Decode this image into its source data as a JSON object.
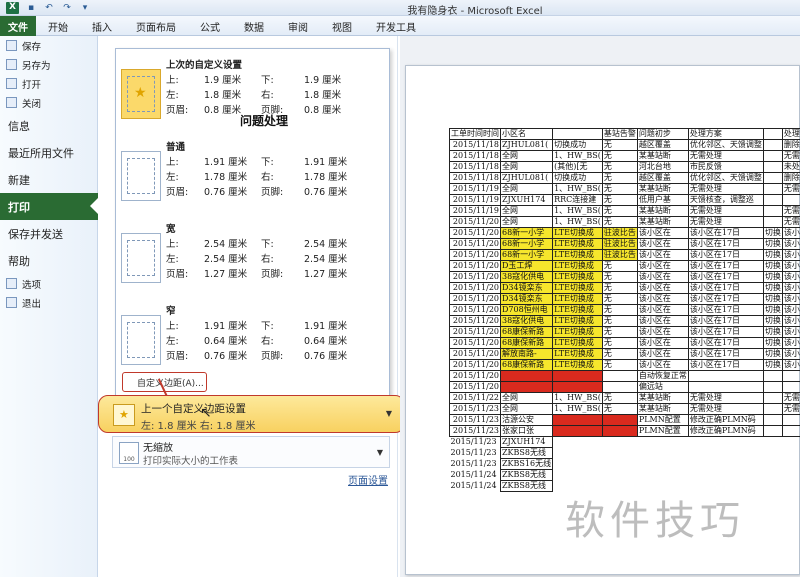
{
  "app": {
    "title": "我有隐身衣 - Microsoft Excel"
  },
  "ribbon": {
    "tabs": [
      "文件",
      "开始",
      "插入",
      "页面布局",
      "公式",
      "数据",
      "审阅",
      "视图",
      "开发工具"
    ]
  },
  "nav": {
    "small_top": [
      {
        "label": "保存",
        "icon": "save-icon"
      },
      {
        "label": "另存为",
        "icon": "save-as-icon"
      },
      {
        "label": "打开",
        "icon": "open-icon"
      },
      {
        "label": "关闭",
        "icon": "close-icon"
      }
    ],
    "big": [
      "信息",
      "最近所用文件",
      "新建",
      "打印",
      "保存并发送",
      "帮助"
    ],
    "active": "打印",
    "small_bottom": [
      {
        "label": "选项",
        "icon": "options-icon"
      },
      {
        "label": "退出",
        "icon": "exit-icon"
      }
    ]
  },
  "margins": {
    "presets": [
      {
        "name": "上次的自定义设置",
        "top": "1.9 厘米",
        "bottom": "1.9 厘米",
        "left": "1.8 厘米",
        "right": "1.8 厘米",
        "header": "0.8 厘米",
        "footer": "0.8 厘米"
      },
      {
        "name": "普通",
        "top": "1.91 厘米",
        "bottom": "1.91 厘米",
        "left": "1.78 厘米",
        "right": "1.78 厘米",
        "header": "0.76 厘米",
        "footer": "0.76 厘米"
      },
      {
        "name": "宽",
        "top": "2.54 厘米",
        "bottom": "2.54 厘米",
        "left": "2.54 厘米",
        "right": "2.54 厘米",
        "header": "1.27 厘米",
        "footer": "1.27 厘米"
      },
      {
        "name": "窄",
        "top": "1.91 厘米",
        "bottom": "1.91 厘米",
        "left": "0.64 厘米",
        "right": "0.64 厘米",
        "header": "0.76 厘米",
        "footer": "0.76 厘米"
      }
    ],
    "labels": {
      "top": "上:",
      "bottom": "下:",
      "left": "左:",
      "right": "右:",
      "header": "页眉:",
      "footer": "页脚:"
    },
    "custom_link": "自定义边距(A)...",
    "last_custom": {
      "title": "上一个自定义边距设置",
      "detail": "左: 1.8 厘米 右: 1.8 厘米"
    }
  },
  "scaling": {
    "title": "无缩放",
    "subtitle": "打印实际大小的工作表",
    "icon_text": "100"
  },
  "page_setup_link": "页面设置",
  "preview": {
    "title": "问题处理",
    "headers": [
      "工单时间时间",
      "小区名",
      "",
      "基站告警",
      "问题初步",
      "处理方案",
      "",
      "处理方案"
    ],
    "rows": [
      {
        "cells": [
          "2015/11/18",
          "ZJHUL081(",
          "切换成功",
          "无",
          "越区覆盖",
          "优化邻区、天馈调整",
          "",
          "删除路"
        ],
        "y": [],
        "r": []
      },
      {
        "cells": [
          "2015/11/18",
          "全网",
          "1、HW_BS(",
          "无",
          "某基站断",
          "无需处理",
          "",
          "无需处"
        ],
        "y": [],
        "r": []
      },
      {
        "cells": [
          "2015/11/18",
          "全网",
          "(其他)[无",
          "无",
          "河北台地",
          "市民反馈",
          "",
          "未处"
        ],
        "y": [],
        "r": []
      },
      {
        "cells": [
          "2015/11/18",
          "ZJHUL081(",
          "切换成功",
          "无",
          "越区覆盖",
          "优化邻区、天馈调整",
          "",
          "删除路"
        ],
        "y": [],
        "r": []
      },
      {
        "cells": [
          "2015/11/19",
          "全网",
          "1、HW_BS(",
          "无",
          "某基站断",
          "无需处理",
          "",
          "无需处"
        ],
        "y": [],
        "r": []
      },
      {
        "cells": [
          "2015/11/19",
          "ZJXUH174",
          "RRC连接建",
          "无",
          "低用户基",
          "天馈核查，调整巡",
          "",
          ""
        ],
        "y": [],
        "r": []
      },
      {
        "cells": [
          "2015/11/19",
          "全网",
          "1、HW_BS(",
          "无",
          "某基站断",
          "无需处理",
          "",
          "无需处"
        ],
        "y": [],
        "r": []
      },
      {
        "cells": [
          "2015/11/20",
          "全网",
          "1、HW_BS(",
          "无",
          "某基站断",
          "无需处理",
          "",
          "无需处"
        ],
        "y": [],
        "r": []
      },
      {
        "cells": [
          "2015/11/20",
          "68新一小学",
          "LTE切换成",
          "驻波比告",
          "该小区在",
          "该小区在17日",
          "切换",
          "该小"
        ],
        "y": [
          1,
          2,
          3
        ],
        "r": []
      },
      {
        "cells": [
          "2015/11/20",
          "68新一小学",
          "LTE切换成",
          "驻波比告",
          "该小区在",
          "该小区在17日",
          "切换",
          "该小"
        ],
        "y": [
          1,
          2,
          3
        ],
        "r": []
      },
      {
        "cells": [
          "2015/11/20",
          "68新一小学",
          "LTE切换成",
          "驻波比告",
          "该小区在",
          "该小区在17日",
          "切换",
          "该小"
        ],
        "y": [
          1,
          2,
          3
        ],
        "r": []
      },
      {
        "cells": [
          "2015/11/20",
          "D玉工焊",
          "LTE切换成",
          "无",
          "该小区在",
          "该小区在17日",
          "切换",
          "该小"
        ],
        "y": [
          1,
          2
        ],
        "r": []
      },
      {
        "cells": [
          "2015/11/20",
          "38寇化供电",
          "LTE切换成",
          "无",
          "该小区在",
          "该小区在17日",
          "切换",
          "该小"
        ],
        "y": [
          1,
          2
        ],
        "r": []
      },
      {
        "cells": [
          "2015/11/20",
          "D34镜栾东",
          "LTE切换成",
          "无",
          "该小区在",
          "该小区在17日",
          "切换",
          "该小"
        ],
        "y": [
          1,
          2
        ],
        "r": []
      },
      {
        "cells": [
          "2015/11/20",
          "D34镜栾东",
          "LTE切换成",
          "无",
          "该小区在",
          "该小区在17日",
          "切换",
          "该小"
        ],
        "y": [
          1,
          2
        ],
        "r": []
      },
      {
        "cells": [
          "2015/11/20",
          "D708恒州电",
          "LTE切换成",
          "无",
          "该小区在",
          "该小区在17日",
          "切换",
          "该小"
        ],
        "y": [
          1,
          2
        ],
        "r": []
      },
      {
        "cells": [
          "2015/11/20",
          "38寇化供电",
          "LTE切换成",
          "无",
          "该小区在",
          "该小区在17日",
          "切换",
          "该小"
        ],
        "y": [
          1,
          2
        ],
        "r": []
      },
      {
        "cells": [
          "2015/11/20",
          "68康保新路",
          "LTE切换成",
          "无",
          "该小区在",
          "该小区在17日",
          "切换",
          "该小"
        ],
        "y": [
          1,
          2
        ],
        "r": []
      },
      {
        "cells": [
          "2015/11/20",
          "68康保新路",
          "LTE切换成",
          "无",
          "该小区在",
          "该小区在17日",
          "切换",
          "该小"
        ],
        "y": [
          1,
          2
        ],
        "r": []
      },
      {
        "cells": [
          "2015/11/20",
          "解放南路-",
          "LTE切换成",
          "无",
          "该小区在",
          "该小区在17日",
          "切换",
          "该小"
        ],
        "y": [
          1,
          2
        ],
        "r": []
      },
      {
        "cells": [
          "2015/11/20",
          "68康保新路",
          "LTE切换成",
          "无",
          "该小区在",
          "该小区在17日",
          "切换",
          "该小"
        ],
        "y": [
          1,
          2
        ],
        "r": []
      },
      {
        "cells": [
          "2015/11/20",
          "",
          "",
          "",
          "自动恢复正常",
          "",
          "",
          ""
        ],
        "y": [],
        "r": [
          1,
          2
        ]
      },
      {
        "cells": [
          "2015/11/20",
          "",
          "",
          "",
          "偏远站",
          "",
          "",
          ""
        ],
        "y": [],
        "r": [
          1,
          2
        ]
      },
      {
        "cells": [
          "2015/11/22",
          "全网",
          "1、HW_BS(",
          "无",
          "某基站断",
          "无需处理",
          "",
          "无需处"
        ],
        "y": [],
        "r": []
      },
      {
        "cells": [
          "2015/11/23",
          "全网",
          "1、HW_BS(",
          "无",
          "某基站断",
          "无需处理",
          "",
          "无需处"
        ],
        "y": [],
        "r": []
      },
      {
        "cells": [
          "2015/11/23",
          "沽源公安",
          "",
          "",
          "PLMN配置",
          "修改正确PLMN码",
          "",
          ""
        ],
        "y": [],
        "r": [
          2,
          3
        ]
      },
      {
        "cells": [
          "2015/11/23",
          "张家口张",
          "",
          "",
          "PLMN配置",
          "修改正确PLMN码",
          "",
          ""
        ],
        "y": [],
        "r": [
          2,
          3
        ]
      }
    ],
    "loose_rows": [
      [
        "2015/11/23",
        "ZJXUH174"
      ],
      [
        "2015/11/23",
        "ZKBS8无线"
      ],
      [
        "2015/11/23",
        "ZKBS16无线"
      ],
      [
        "2015/11/24",
        "ZKBS8无线"
      ],
      [
        "2015/11/24",
        "ZKBS8无线"
      ]
    ]
  },
  "watermark": "软件技巧"
}
